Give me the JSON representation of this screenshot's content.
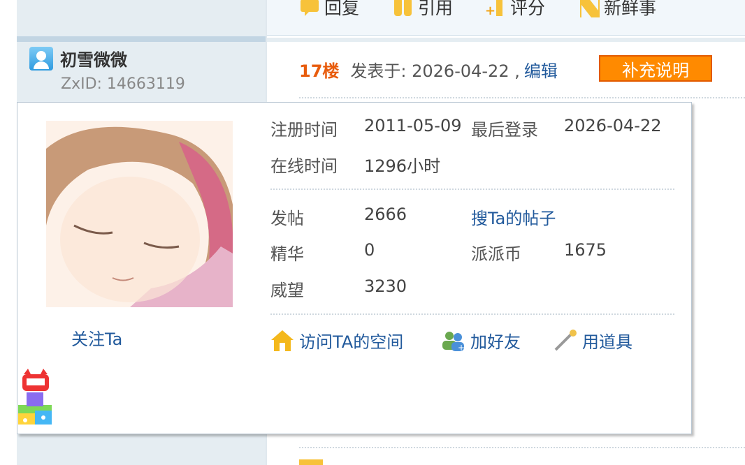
{
  "post_actions": [
    {
      "label": "回复",
      "icon": "reply-icon"
    },
    {
      "label": "引用",
      "icon": "quote-icon"
    },
    {
      "label": "评分",
      "icon": "rate-icon"
    },
    {
      "label": "新鲜事",
      "icon": "news-icon"
    }
  ],
  "author": {
    "name": "初雪微微",
    "zxid": "ZxID:  14663119"
  },
  "post": {
    "floor": "17楼",
    "posted_at": "发表于: 2026-04-22 ,",
    "edit": "编辑",
    "supplement": "补充说明"
  },
  "profile_card": {
    "follow": "关注Ta",
    "register_label": "注册时间",
    "register_value": "2011-05-09",
    "last_login_label": "最后登录",
    "last_login_value": "2026-04-22",
    "online_label": "在线时间",
    "online_value": "1296小时",
    "stats": {
      "posts_label": "发帖",
      "posts_value": "2666",
      "search_posts": "搜Ta的帖子",
      "digest_label": "精华",
      "digest_value": "0",
      "coins_label": "派派币",
      "coins_value": "1675",
      "prestige_label": "威望",
      "prestige_value": "3230"
    },
    "actions": [
      {
        "label": "访问TA的空间",
        "icon": "home-icon"
      },
      {
        "label": "加好友",
        "icon": "add-friend-icon"
      },
      {
        "label": "用道具",
        "icon": "tool-icon"
      }
    ]
  },
  "colors": {
    "accent_link": "#225a9c",
    "floor_orange": "#e85c0d",
    "button_orange": "#ff8a00"
  }
}
